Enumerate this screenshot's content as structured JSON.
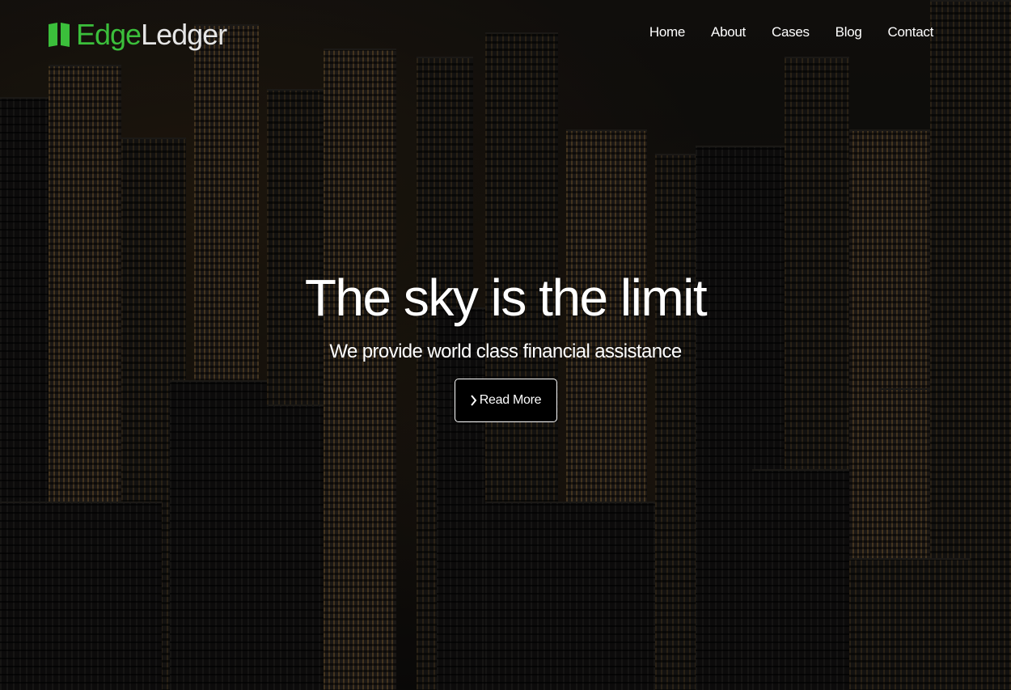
{
  "brand": {
    "name_part1": "Edge",
    "name_part2": "Ledger",
    "icon": "book-icon",
    "accent_color": "#3bbf3b"
  },
  "nav": {
    "items": [
      {
        "label": "Home"
      },
      {
        "label": "About"
      },
      {
        "label": "Cases"
      },
      {
        "label": "Blog"
      },
      {
        "label": "Contact"
      }
    ]
  },
  "hero": {
    "title": "The sky is the limit",
    "subtitle": "We provide world class financial assistance",
    "cta": {
      "label": "Read More",
      "icon": "chevron-right-icon"
    },
    "background": "city-skyline-night-photo"
  }
}
